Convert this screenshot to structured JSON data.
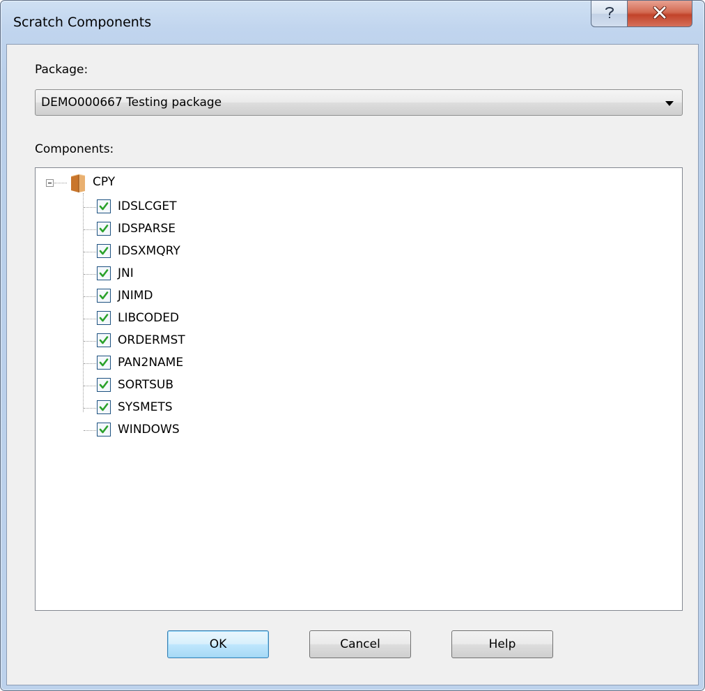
{
  "window": {
    "title": "Scratch Components",
    "help_icon": "question-mark-icon",
    "close_icon": "close-x-icon"
  },
  "package": {
    "label": "Package:",
    "selected_value": "DEMO000667   Testing package"
  },
  "components": {
    "label": "Components:",
    "root": {
      "label": "CPY",
      "icon": "folder-icon",
      "expanded": true,
      "children": [
        {
          "label": "IDSLCGET",
          "checked": true
        },
        {
          "label": "IDSPARSE",
          "checked": true
        },
        {
          "label": "IDSXMQRY",
          "checked": true
        },
        {
          "label": "JNI",
          "checked": true
        },
        {
          "label": "JNIMD",
          "checked": true
        },
        {
          "label": "LIBCODED",
          "checked": true
        },
        {
          "label": "ORDERMST",
          "checked": true
        },
        {
          "label": "PAN2NAME",
          "checked": true
        },
        {
          "label": "SORTSUB",
          "checked": true
        },
        {
          "label": "SYSMETS",
          "checked": true
        },
        {
          "label": "WINDOWS",
          "checked": true
        }
      ]
    }
  },
  "buttons": {
    "ok": "OK",
    "cancel": "Cancel",
    "help": "Help"
  },
  "colors": {
    "checkmark": "#2aa12a",
    "checkbox_border": "#1d5180",
    "title_bar": "#c1d5ee",
    "close_button": "#c2432a"
  }
}
